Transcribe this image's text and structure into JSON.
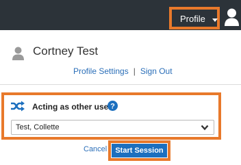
{
  "header": {
    "profile_label": "Profile",
    "icons": {
      "caret": "caret-down-icon",
      "avatar": "user-avatar-icon"
    }
  },
  "user": {
    "name": "Cortney Test",
    "profile_settings_label": "Profile Settings",
    "separator": "|",
    "sign_out_label": "Sign Out"
  },
  "acting": {
    "label": "Acting as other user",
    "icons": {
      "shuffle": "shuffle-icon",
      "help": "help-icon"
    },
    "selected_user": "Test, Collette"
  },
  "actions": {
    "cancel_label": "Cancel",
    "start_label": "Start Session"
  },
  "colors": {
    "highlight": "#e8792b",
    "topbar": "#2c3339",
    "link": "#2a6eb8",
    "primary_button": "#1c6fbe"
  }
}
